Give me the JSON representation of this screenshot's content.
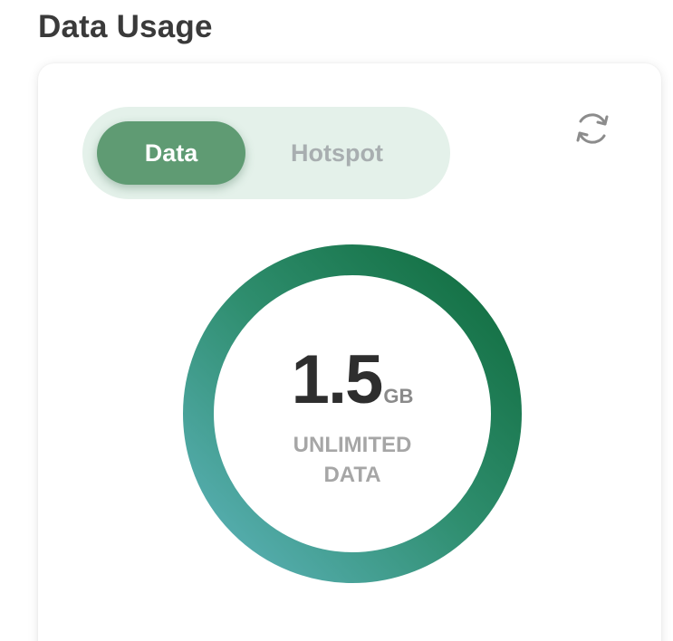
{
  "section": {
    "title": "Data Usage"
  },
  "toggle": {
    "options": [
      {
        "label": "Data",
        "active": true
      },
      {
        "label": "Hotspot",
        "active": false
      }
    ]
  },
  "refresh": {
    "icon": "refresh-icon"
  },
  "usage": {
    "value": "1.5",
    "unit": "GB",
    "label_line1": "UNLIMITED",
    "label_line2": "DATA"
  },
  "colors": {
    "active_toggle": "#5f9b73",
    "toggle_track": "#e4f1ea",
    "ring_start": "#5db3bb",
    "ring_end": "#0f6b3c"
  }
}
